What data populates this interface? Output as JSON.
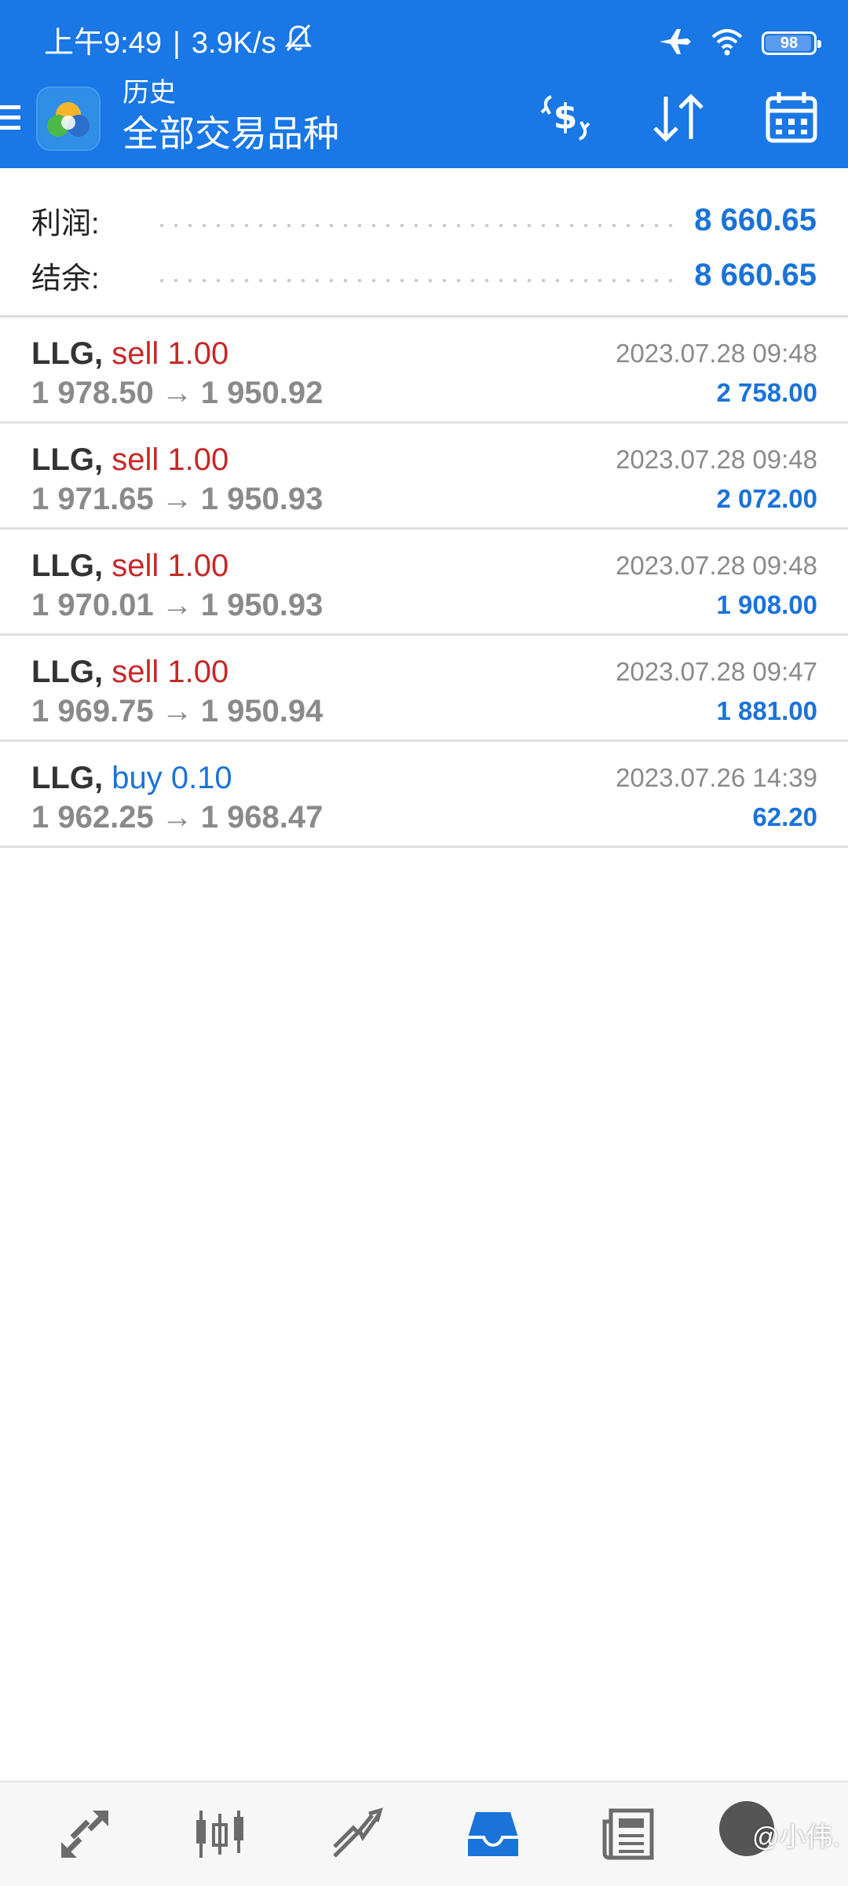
{
  "status_bar": {
    "time": "上午9:49",
    "separator": "|",
    "net_speed": "3.9K/s",
    "battery": "98",
    "icons": [
      "bell-off-icon",
      "airplane-icon",
      "wifi-icon",
      "battery-icon"
    ]
  },
  "header": {
    "title": "历史",
    "subtitle": "全部交易品种",
    "actions": [
      "currency-exchange-icon",
      "sort-icon",
      "calendar-icon"
    ]
  },
  "summary": {
    "profit_label": "利润:",
    "profit_value": "8 660.65",
    "balance_label": "结余:",
    "balance_value": "8 660.65"
  },
  "deals": [
    {
      "symbol": "LLG,",
      "type": "sell 1.00",
      "side": "sell",
      "open": "1 978.50",
      "arrow": "→",
      "close": "1 950.92",
      "time": "2023.07.28 09:48",
      "profit": "2 758.00"
    },
    {
      "symbol": "LLG,",
      "type": "sell 1.00",
      "side": "sell",
      "open": "1 971.65",
      "arrow": "→",
      "close": "1 950.93",
      "time": "2023.07.28 09:48",
      "profit": "2 072.00"
    },
    {
      "symbol": "LLG,",
      "type": "sell 1.00",
      "side": "sell",
      "open": "1 970.01",
      "arrow": "→",
      "close": "1 950.93",
      "time": "2023.07.28 09:48",
      "profit": "1 908.00"
    },
    {
      "symbol": "LLG,",
      "type": "sell 1.00",
      "side": "sell",
      "open": "1 969.75",
      "arrow": "→",
      "close": "1 950.94",
      "time": "2023.07.28 09:47",
      "profit": "1 881.00"
    },
    {
      "symbol": "LLG,",
      "type": "buy 0.10",
      "side": "buy",
      "open": "1 962.25",
      "arrow": "→",
      "close": "1 968.47",
      "time": "2023.07.26 14:39",
      "profit": "62.20"
    }
  ],
  "bottom_nav": {
    "items": [
      "quotes-icon",
      "chart-icon",
      "trade-icon",
      "history-icon",
      "news-icon",
      "settings-icon"
    ],
    "active": "history-icon",
    "watermark": "@小伟."
  },
  "colors": {
    "primary": "#1977e6",
    "sell": "#c62828",
    "buy": "#1a73d9",
    "profit": "#1a73d9",
    "muted": "#8a8a8a"
  }
}
